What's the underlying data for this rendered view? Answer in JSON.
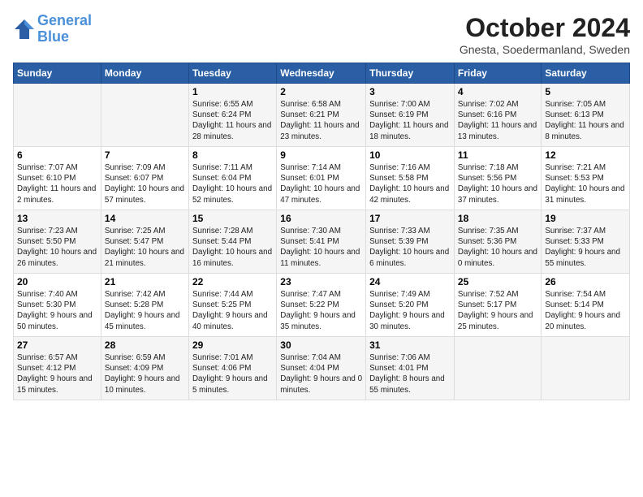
{
  "header": {
    "logo_line1": "General",
    "logo_line2": "Blue",
    "month": "October 2024",
    "location": "Gnesta, Soedermanland, Sweden"
  },
  "weekdays": [
    "Sunday",
    "Monday",
    "Tuesday",
    "Wednesday",
    "Thursday",
    "Friday",
    "Saturday"
  ],
  "weeks": [
    [
      {
        "day": "",
        "content": ""
      },
      {
        "day": "",
        "content": ""
      },
      {
        "day": "1",
        "content": "Sunrise: 6:55 AM\nSunset: 6:24 PM\nDaylight: 11 hours\nand 28 minutes."
      },
      {
        "day": "2",
        "content": "Sunrise: 6:58 AM\nSunset: 6:21 PM\nDaylight: 11 hours\nand 23 minutes."
      },
      {
        "day": "3",
        "content": "Sunrise: 7:00 AM\nSunset: 6:19 PM\nDaylight: 11 hours\nand 18 minutes."
      },
      {
        "day": "4",
        "content": "Sunrise: 7:02 AM\nSunset: 6:16 PM\nDaylight: 11 hours\nand 13 minutes."
      },
      {
        "day": "5",
        "content": "Sunrise: 7:05 AM\nSunset: 6:13 PM\nDaylight: 11 hours\nand 8 minutes."
      }
    ],
    [
      {
        "day": "6",
        "content": "Sunrise: 7:07 AM\nSunset: 6:10 PM\nDaylight: 11 hours\nand 2 minutes."
      },
      {
        "day": "7",
        "content": "Sunrise: 7:09 AM\nSunset: 6:07 PM\nDaylight: 10 hours\nand 57 minutes."
      },
      {
        "day": "8",
        "content": "Sunrise: 7:11 AM\nSunset: 6:04 PM\nDaylight: 10 hours\nand 52 minutes."
      },
      {
        "day": "9",
        "content": "Sunrise: 7:14 AM\nSunset: 6:01 PM\nDaylight: 10 hours\nand 47 minutes."
      },
      {
        "day": "10",
        "content": "Sunrise: 7:16 AM\nSunset: 5:58 PM\nDaylight: 10 hours\nand 42 minutes."
      },
      {
        "day": "11",
        "content": "Sunrise: 7:18 AM\nSunset: 5:56 PM\nDaylight: 10 hours\nand 37 minutes."
      },
      {
        "day": "12",
        "content": "Sunrise: 7:21 AM\nSunset: 5:53 PM\nDaylight: 10 hours\nand 31 minutes."
      }
    ],
    [
      {
        "day": "13",
        "content": "Sunrise: 7:23 AM\nSunset: 5:50 PM\nDaylight: 10 hours\nand 26 minutes."
      },
      {
        "day": "14",
        "content": "Sunrise: 7:25 AM\nSunset: 5:47 PM\nDaylight: 10 hours\nand 21 minutes."
      },
      {
        "day": "15",
        "content": "Sunrise: 7:28 AM\nSunset: 5:44 PM\nDaylight: 10 hours\nand 16 minutes."
      },
      {
        "day": "16",
        "content": "Sunrise: 7:30 AM\nSunset: 5:41 PM\nDaylight: 10 hours\nand 11 minutes."
      },
      {
        "day": "17",
        "content": "Sunrise: 7:33 AM\nSunset: 5:39 PM\nDaylight: 10 hours\nand 6 minutes."
      },
      {
        "day": "18",
        "content": "Sunrise: 7:35 AM\nSunset: 5:36 PM\nDaylight: 10 hours\nand 0 minutes."
      },
      {
        "day": "19",
        "content": "Sunrise: 7:37 AM\nSunset: 5:33 PM\nDaylight: 9 hours\nand 55 minutes."
      }
    ],
    [
      {
        "day": "20",
        "content": "Sunrise: 7:40 AM\nSunset: 5:30 PM\nDaylight: 9 hours\nand 50 minutes."
      },
      {
        "day": "21",
        "content": "Sunrise: 7:42 AM\nSunset: 5:28 PM\nDaylight: 9 hours\nand 45 minutes."
      },
      {
        "day": "22",
        "content": "Sunrise: 7:44 AM\nSunset: 5:25 PM\nDaylight: 9 hours\nand 40 minutes."
      },
      {
        "day": "23",
        "content": "Sunrise: 7:47 AM\nSunset: 5:22 PM\nDaylight: 9 hours\nand 35 minutes."
      },
      {
        "day": "24",
        "content": "Sunrise: 7:49 AM\nSunset: 5:20 PM\nDaylight: 9 hours\nand 30 minutes."
      },
      {
        "day": "25",
        "content": "Sunrise: 7:52 AM\nSunset: 5:17 PM\nDaylight: 9 hours\nand 25 minutes."
      },
      {
        "day": "26",
        "content": "Sunrise: 7:54 AM\nSunset: 5:14 PM\nDaylight: 9 hours\nand 20 minutes."
      }
    ],
    [
      {
        "day": "27",
        "content": "Sunrise: 6:57 AM\nSunset: 4:12 PM\nDaylight: 9 hours\nand 15 minutes."
      },
      {
        "day": "28",
        "content": "Sunrise: 6:59 AM\nSunset: 4:09 PM\nDaylight: 9 hours\nand 10 minutes."
      },
      {
        "day": "29",
        "content": "Sunrise: 7:01 AM\nSunset: 4:06 PM\nDaylight: 9 hours\nand 5 minutes."
      },
      {
        "day": "30",
        "content": "Sunrise: 7:04 AM\nSunset: 4:04 PM\nDaylight: 9 hours\nand 0 minutes."
      },
      {
        "day": "31",
        "content": "Sunrise: 7:06 AM\nSunset: 4:01 PM\nDaylight: 8 hours\nand 55 minutes."
      },
      {
        "day": "",
        "content": ""
      },
      {
        "day": "",
        "content": ""
      }
    ]
  ]
}
